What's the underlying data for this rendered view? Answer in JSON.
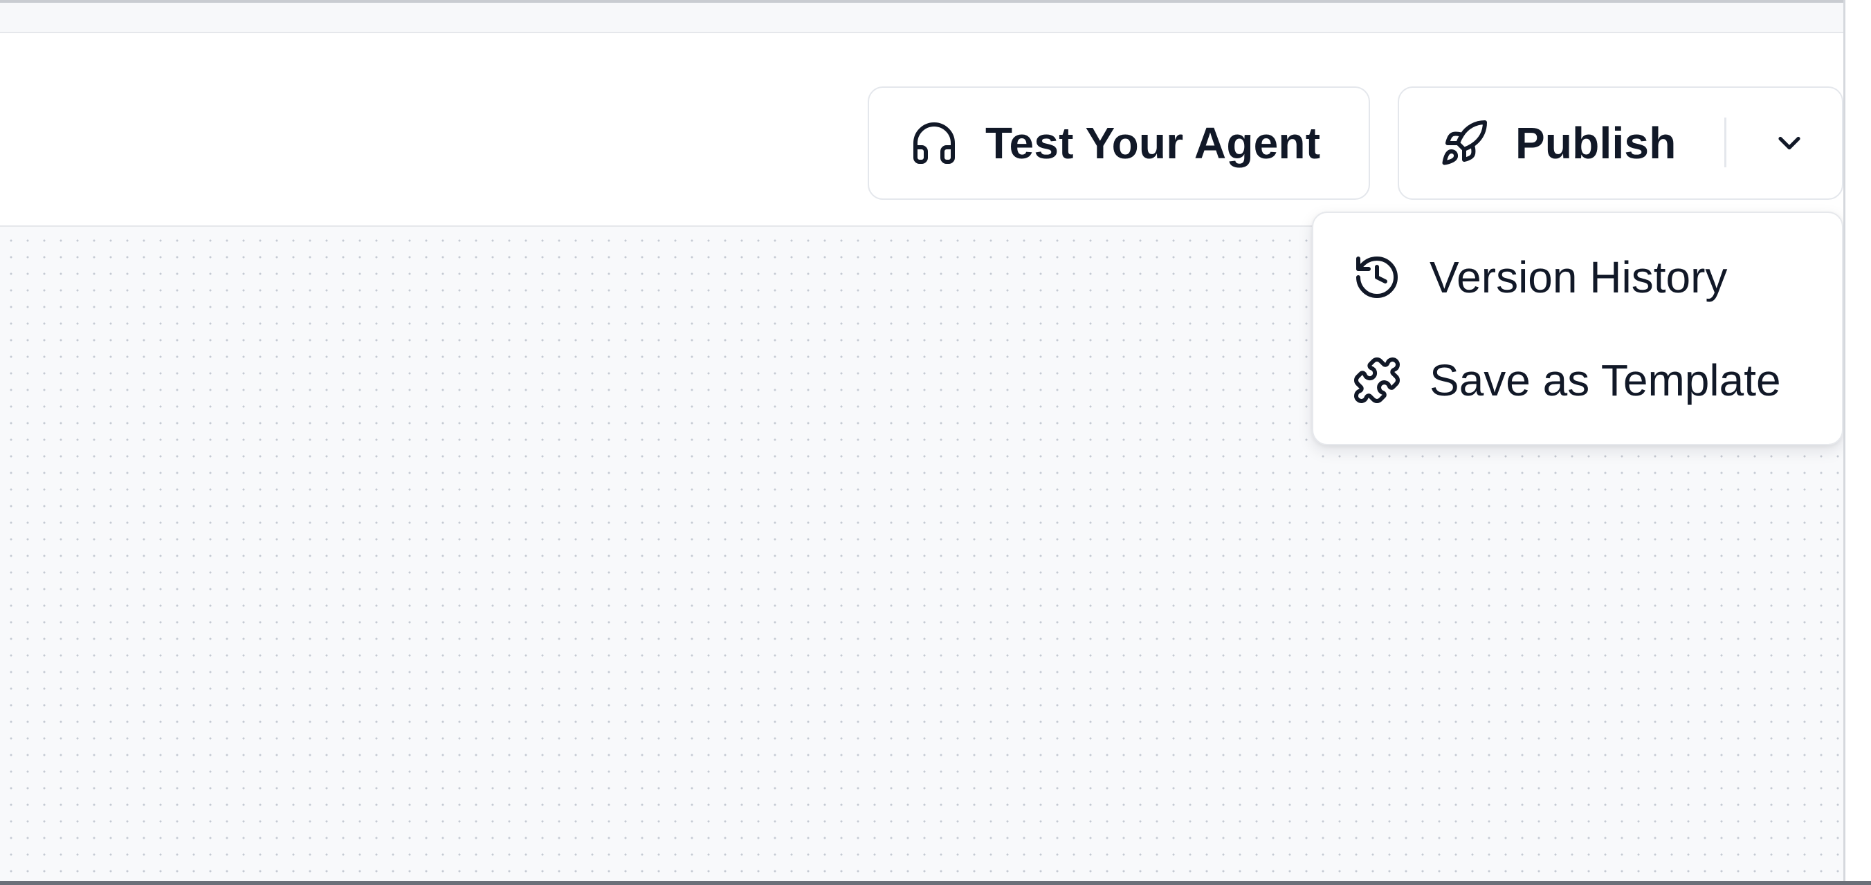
{
  "toolbar": {
    "test_agent_label": "Test Your Agent",
    "test_agent_icon": "headset-icon",
    "publish_label": "Publish",
    "publish_icon": "rocket-icon",
    "publish_menu_toggle_icon": "chevron-down-icon"
  },
  "publish_menu": {
    "items": [
      {
        "label": "Version History",
        "icon": "history-icon"
      },
      {
        "label": "Save as Template",
        "icon": "puzzle-icon"
      }
    ]
  },
  "colors": {
    "text": "#111827",
    "border": "#e4e7ec",
    "canvas_bg": "#f8f9fb",
    "canvas_dot": "#c5cad3"
  }
}
